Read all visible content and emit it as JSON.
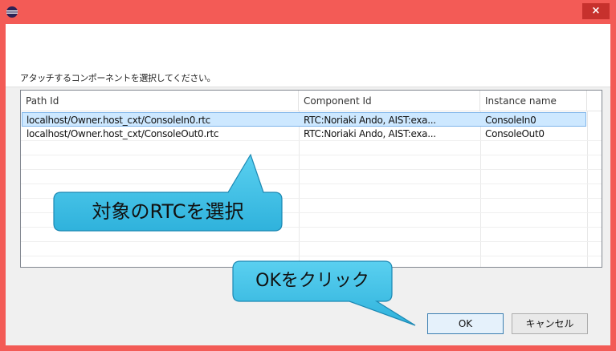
{
  "window": {
    "close_glyph": "×",
    "frame_color": "#f35b56"
  },
  "dialog": {
    "prompt": "アタッチするコンポーネントを選択してください。"
  },
  "table": {
    "columns": [
      "Path Id",
      "Component Id",
      "Instance name"
    ],
    "rows": [
      {
        "path": "localhost/Owner.host_cxt/ConsoleIn0.rtc",
        "component": "RTC:Noriaki Ando, AIST:exa...",
        "instance": "ConsoleIn0",
        "selected": true
      },
      {
        "path": "localhost/Owner.host_cxt/ConsoleOut0.rtc",
        "component": "RTC:Noriaki Ando, AIST:exa...",
        "instance": "ConsoleOut0",
        "selected": false
      }
    ]
  },
  "callouts": {
    "select_rtc": "対象のRTCを選択",
    "click_ok": "OKをクリック"
  },
  "buttons": {
    "ok": "OK",
    "cancel": "キャンセル"
  }
}
